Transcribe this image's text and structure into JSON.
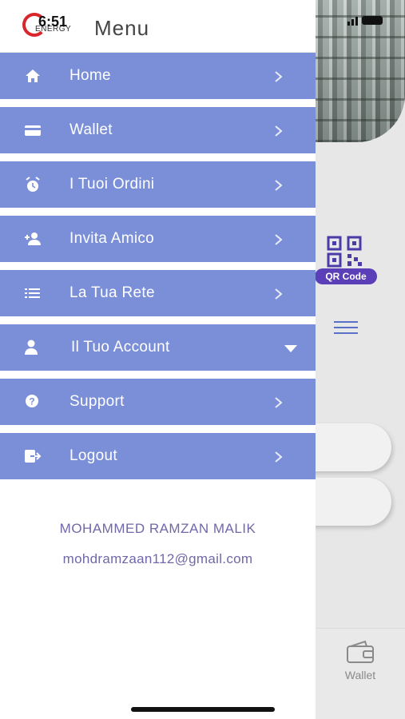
{
  "status_bar": {
    "time": "6:51"
  },
  "drawer": {
    "logo_text": "ENERGY",
    "title": "Menu",
    "items": [
      {
        "label": "Home",
        "icon": "home-icon",
        "indicator": "chevron-right"
      },
      {
        "label": "Wallet",
        "icon": "card-icon",
        "indicator": "chevron-right"
      },
      {
        "label": "I Tuoi Ordini",
        "icon": "alarm-icon",
        "indicator": "chevron-right"
      },
      {
        "label": "Invita Amico",
        "icon": "add-person-icon",
        "indicator": "chevron-right"
      },
      {
        "label": "La Tua Rete",
        "icon": "list-icon",
        "indicator": "chevron-right"
      },
      {
        "label": "Il Tuo Account",
        "icon": "person-icon",
        "indicator": "caret-down"
      },
      {
        "label": "Support",
        "icon": "help-icon",
        "indicator": "chevron-right"
      },
      {
        "label": "Logout",
        "icon": "logout-icon",
        "indicator": "chevron-right"
      }
    ],
    "user": {
      "name": "MOHAMMED RAMZAN MALIK",
      "email": "mohdramzaan112@gmail.com"
    }
  },
  "background": {
    "qr_label": "QR Code",
    "bottom_tab_label": "Wallet"
  },
  "colors": {
    "menu_item_bg": "#7b8fd8",
    "qr_accent": "#5a3fb8",
    "user_text": "#7068a8"
  }
}
